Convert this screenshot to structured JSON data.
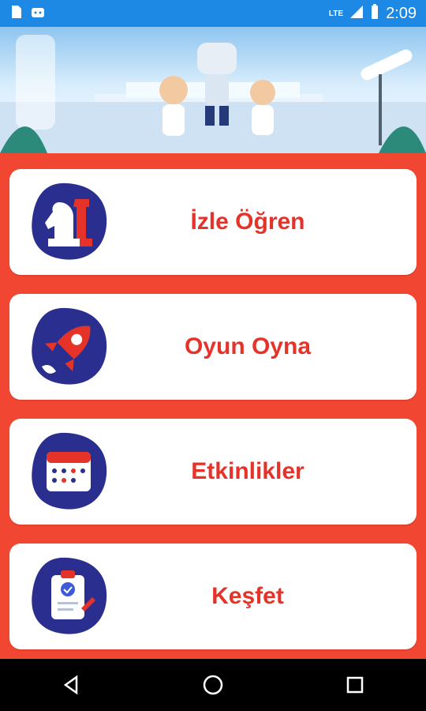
{
  "status_bar": {
    "time": "2:09",
    "network": "LTE"
  },
  "menu": [
    {
      "label": "İzle Öğren",
      "icon": "chess-icon"
    },
    {
      "label": "Oyun Oyna",
      "icon": "rocket-icon"
    },
    {
      "label": "Etkinlikler",
      "icon": "calendar-icon"
    },
    {
      "label": "Keşfet",
      "icon": "clipboard-icon"
    }
  ],
  "colors": {
    "background": "#f04632",
    "accent_text": "#e6332a",
    "icon_blob": "#2a2f8f",
    "status_bar": "#1e88e5"
  }
}
